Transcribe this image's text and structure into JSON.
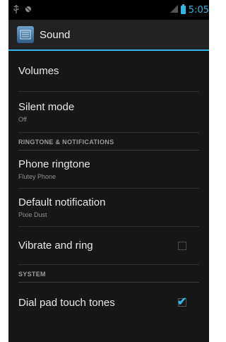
{
  "status_bar": {
    "time": "5:05",
    "icons": [
      "usb-icon",
      "android-debug-icon",
      "signal-icon",
      "battery-icon"
    ],
    "accent_color": "#33b5e5"
  },
  "action_bar": {
    "title": "Sound",
    "icon": "sound-settings-icon"
  },
  "items": {
    "volumes": {
      "title": "Volumes"
    },
    "silent_mode": {
      "title": "Silent mode",
      "summary": "Off"
    },
    "header_ringtone": "RINGTONE & NOTIFICATIONS",
    "phone_ringtone": {
      "title": "Phone ringtone",
      "summary": "Flutey Phone"
    },
    "default_notification": {
      "title": "Default notification",
      "summary": "Pixie Dust"
    },
    "vibrate_and_ring": {
      "title": "Vibrate and ring",
      "checked": false
    },
    "header_system": "SYSTEM",
    "dial_pad_touch_tones": {
      "title": "Dial pad touch tones",
      "checked": true
    }
  }
}
